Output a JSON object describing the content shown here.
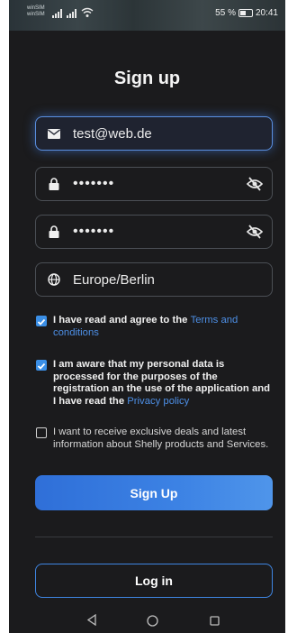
{
  "status_bar": {
    "carrier_line1": "winSIM",
    "carrier_line2": "winSIM",
    "battery_percent": "55 %",
    "time": "20:41"
  },
  "title": "Sign up",
  "form": {
    "email": {
      "value": "test@web.de",
      "icon": "mail-icon"
    },
    "password": {
      "value": "•••••••",
      "icon": "lock-icon",
      "toggle_icon": "eye-off-icon"
    },
    "confirm_password": {
      "value": "•••••••",
      "icon": "lock-icon",
      "toggle_icon": "eye-off-icon"
    },
    "timezone": {
      "value": "Europe/Berlin",
      "icon": "globe-icon"
    }
  },
  "checkboxes": {
    "terms": {
      "checked": true,
      "text": "I have read and agree to the ",
      "link": "Terms and conditions"
    },
    "privacy": {
      "checked": true,
      "text": "I am aware that my personal data is processed for the purposes of the registration an the use of the application and I have read the ",
      "link": "Privacy policy"
    },
    "marketing": {
      "checked": false,
      "text": "I want to receive exclusive deals and latest information about Shelly products and Services."
    }
  },
  "buttons": {
    "sign_up": "Sign Up",
    "log_in": "Log in"
  },
  "colors": {
    "background": "#1b1b1d",
    "accent": "#3c82e4",
    "link": "#4d8fe6"
  }
}
